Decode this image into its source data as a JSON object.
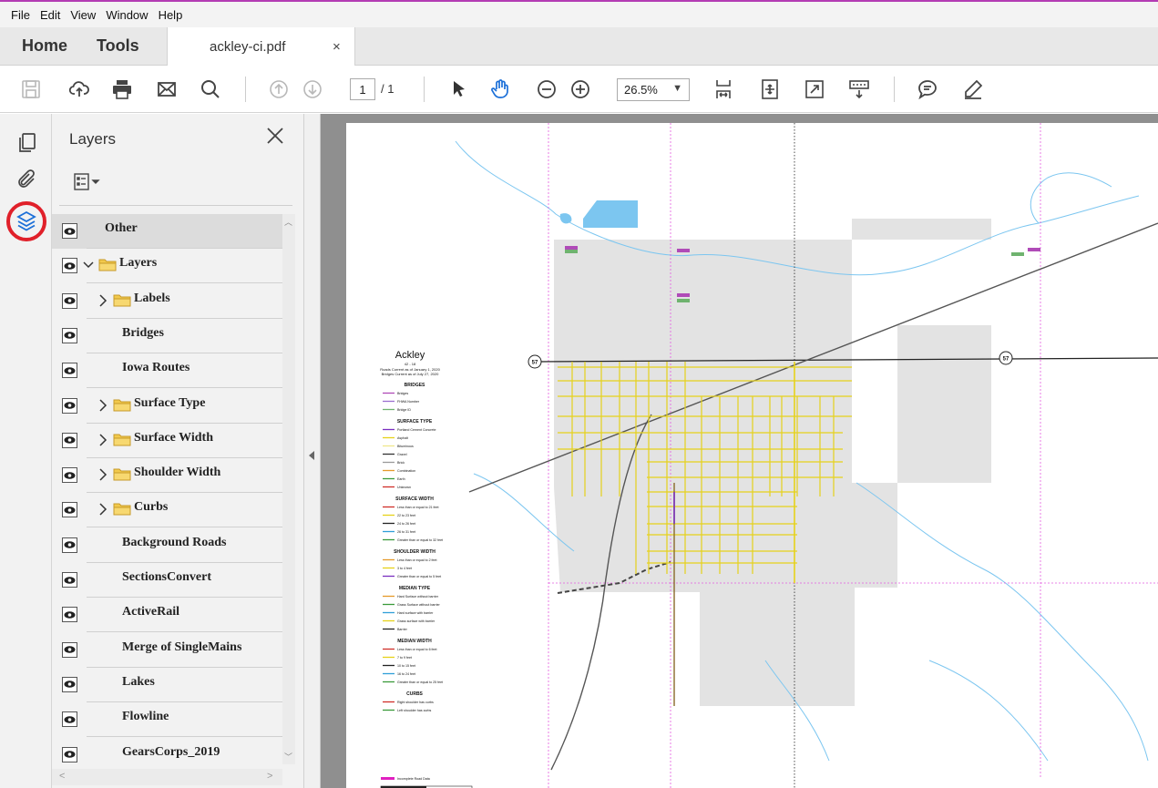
{
  "menu": [
    "File",
    "Edit",
    "View",
    "Window",
    "Help"
  ],
  "tabs": {
    "home": "Home",
    "tools": "Tools",
    "document": "ackley-ci.pdf",
    "close_glyph": "×"
  },
  "toolbar": {
    "page_current": "1",
    "page_total": "/ 1",
    "zoom": "26.5%",
    "zoom_caret": "▼"
  },
  "panel": {
    "title": "Layers",
    "layers": [
      {
        "label": "Other",
        "expandable": false,
        "expanded": false,
        "folder": false,
        "indent": 0,
        "selected": true
      },
      {
        "label": "Layers",
        "expandable": true,
        "expanded": true,
        "folder": true,
        "indent": 0,
        "selected": false
      },
      {
        "label": "Labels",
        "expandable": true,
        "expanded": false,
        "folder": true,
        "indent": 1,
        "selected": false
      },
      {
        "label": "Bridges",
        "expandable": false,
        "expanded": false,
        "folder": false,
        "indent": 1,
        "selected": false
      },
      {
        "label": "Iowa Routes",
        "expandable": false,
        "expanded": false,
        "folder": false,
        "indent": 1,
        "selected": false
      },
      {
        "label": "Surface Type",
        "expandable": true,
        "expanded": false,
        "folder": true,
        "indent": 1,
        "selected": false
      },
      {
        "label": "Surface Width",
        "expandable": true,
        "expanded": false,
        "folder": true,
        "indent": 1,
        "selected": false
      },
      {
        "label": "Shoulder Width",
        "expandable": true,
        "expanded": false,
        "folder": true,
        "indent": 1,
        "selected": false
      },
      {
        "label": "Curbs",
        "expandable": true,
        "expanded": false,
        "folder": true,
        "indent": 1,
        "selected": false
      },
      {
        "label": "Background Roads",
        "expandable": false,
        "expanded": false,
        "folder": false,
        "indent": 1,
        "selected": false
      },
      {
        "label": "SectionsConvert",
        "expandable": false,
        "expanded": false,
        "folder": false,
        "indent": 1,
        "selected": false
      },
      {
        "label": "ActiveRail",
        "expandable": false,
        "expanded": false,
        "folder": false,
        "indent": 1,
        "selected": false
      },
      {
        "label": "Merge of SingleMains",
        "expandable": false,
        "expanded": false,
        "folder": false,
        "indent": 1,
        "selected": false
      },
      {
        "label": "Lakes",
        "expandable": false,
        "expanded": false,
        "folder": false,
        "indent": 1,
        "selected": false
      },
      {
        "label": "Flowline",
        "expandable": false,
        "expanded": false,
        "folder": false,
        "indent": 1,
        "selected": false
      },
      {
        "label": "GearsCorps_2019",
        "expandable": false,
        "expanded": false,
        "folder": false,
        "indent": 1,
        "selected": false
      }
    ]
  },
  "map": {
    "title": "Ackley",
    "subtitle": "42 - 18",
    "roads_line": "Roads Current as of January 1, 2020",
    "bridges_line": "Bridges Current as of July 27, 2020",
    "highway_shield": "57",
    "legend": [
      {
        "heading": "BRIDGES",
        "items": [
          {
            "label": "Bridges",
            "color": "#b04bb8"
          },
          {
            "label": "FHWA Number",
            "color": "#9b6fd0"
          },
          {
            "label": "Bridge ID",
            "color": "#6fb36f"
          }
        ]
      },
      {
        "heading": "SURFACE TYPE",
        "items": [
          {
            "label": "Portland Cement Concrete",
            "color": "#7b2fbf"
          },
          {
            "label": "Asphalt",
            "color": "#e6d21a"
          },
          {
            "label": "Bituminous",
            "color": "#f0e68c"
          },
          {
            "label": "Gravel",
            "color": "#333333"
          },
          {
            "label": "Brick",
            "color": "#999999"
          },
          {
            "label": "Combination",
            "color": "#e59a2b"
          },
          {
            "label": "Earth",
            "color": "#3a9a3a"
          },
          {
            "label": "Unknown",
            "color": "#d0302b"
          }
        ]
      },
      {
        "heading": "SURFACE WIDTH",
        "items": [
          {
            "label": "Less than or equal to 21 feet",
            "color": "#d0302b"
          },
          {
            "label": "22 to 23 feet",
            "color": "#e6d21a"
          },
          {
            "label": "24 to 26 feet",
            "color": "#222222"
          },
          {
            "label": "26 to 31 feet",
            "color": "#2f9fd8"
          },
          {
            "label": "Greater than or equal to 32 feet",
            "color": "#3a9a3a"
          }
        ]
      },
      {
        "heading": "SHOULDER WIDTH",
        "items": [
          {
            "label": "Less than or equal to 2 feet",
            "color": "#e59a2b"
          },
          {
            "label": "3 to 4 feet",
            "color": "#e6d21a"
          },
          {
            "label": "Greater than or equal to 5 feet",
            "color": "#7b2fbf"
          }
        ]
      },
      {
        "heading": "MEDIAN TYPE",
        "items": [
          {
            "label": "Hard Surface without barrier",
            "color": "#e59a2b"
          },
          {
            "label": "Grass Surface without barrier",
            "color": "#3a9a3a"
          },
          {
            "label": "Hard surface with barrier",
            "color": "#2f9fd8"
          },
          {
            "label": "Grass surface with barrier",
            "color": "#e6d21a"
          },
          {
            "label": "Barrier",
            "color": "#222222"
          }
        ]
      },
      {
        "heading": "MEDIAN WIDTH",
        "items": [
          {
            "label": "Less than or equal to 6 feet",
            "color": "#d0302b"
          },
          {
            "label": "7 to 9 feet",
            "color": "#e6d21a"
          },
          {
            "label": "10 to 15 feet",
            "color": "#222222"
          },
          {
            "label": "16 to 24 feet",
            "color": "#2f9fd8"
          },
          {
            "label": "Greater than or equal to 25 feet",
            "color": "#3a9a3a"
          }
        ]
      },
      {
        "heading": "CURBS",
        "items": [
          {
            "label": "Right shoulder has curbs",
            "color": "#d0302b"
          },
          {
            "label": "Left shoulder has curbs",
            "color": "#3a9a3a"
          }
        ]
      }
    ],
    "footer_legend": {
      "label": "Incomplete Road Data",
      "color": "#e020c0"
    },
    "colors": {
      "city": "#e3e3e3",
      "road": "#e6d21a",
      "section": "#e35be0",
      "water": "#7cc6f0",
      "rail": "#555555"
    }
  }
}
